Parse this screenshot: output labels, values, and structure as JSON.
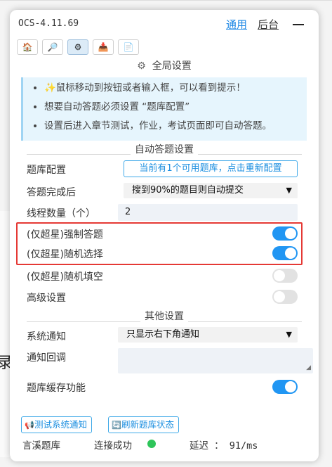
{
  "header": {
    "app_title": "OCS-4.11.69",
    "nav_general": "通用",
    "nav_backend": "后台"
  },
  "tabs": [
    {
      "icon": "home-icon",
      "glyph": "🏠"
    },
    {
      "icon": "search-icon",
      "glyph": "🔎"
    },
    {
      "icon": "gear-icon",
      "glyph": "⚙"
    },
    {
      "icon": "inbox-tray-icon",
      "glyph": "📥"
    },
    {
      "icon": "document-icon",
      "glyph": "📄"
    }
  ],
  "global": {
    "title": "全局设置",
    "tips": [
      "✨鼠标移动到按钮或者输入框，可以看到提示！",
      "想要自动答题必须设置 “题库配置”",
      "设置后进入章节测试，作业，考试页面即可自动答题。"
    ]
  },
  "auto": {
    "title": "自动答题设置",
    "bank_label": "题库配置",
    "bank_button": "当前有1个可用题库，点击重新配置",
    "finish_label": "答题完成后",
    "finish_value": "搜到90%的题目则自动提交",
    "threads_label": "线程数量（个）",
    "threads_value": "2",
    "force_label": "(仅超星)强制答题",
    "force_on": true,
    "random_select_label": "(仅超星)随机选择",
    "random_select_on": true,
    "random_fill_label": "(仅超星)随机填空",
    "random_fill_on": false,
    "advanced_label": "高级设置",
    "advanced_on": false
  },
  "other": {
    "title": "其他设置",
    "notify_label": "系统通知",
    "notify_value": "只显示右下角通知",
    "callback_label": "通知回调",
    "callback_value": "",
    "cache_label": "题库缓存功能",
    "cache_on": true
  },
  "footer": {
    "test_notify": "测试系统通知",
    "refresh_status": "刷新题库状态",
    "bank_name": "言溪题库",
    "conn_status": "连接成功",
    "latency": "延迟 ： 91/ms"
  },
  "background": {
    "text": "录"
  },
  "colors": {
    "accent": "#1e88e5",
    "toggle_on": "#2196f3",
    "highlight": "#e53935",
    "status_ok": "#2ec55a"
  }
}
